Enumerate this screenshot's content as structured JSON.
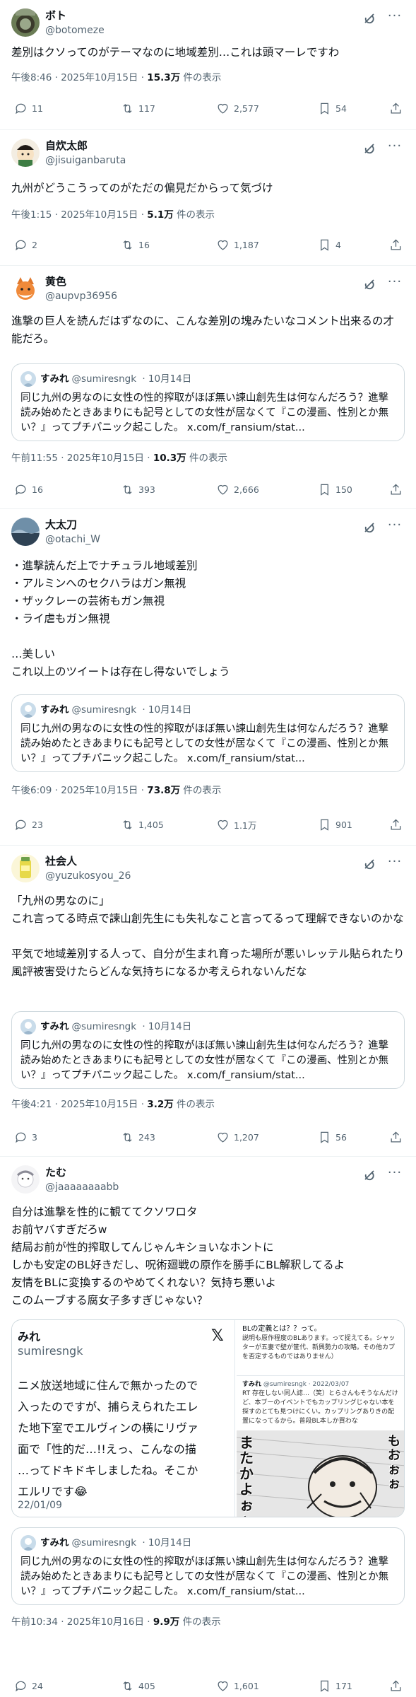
{
  "ui": {
    "more_glyph": "···",
    "views_suffix": "件の表示",
    "separator": " · ",
    "colors": {
      "text": "#0f1419",
      "secondary": "#536471",
      "border": "#cfd9de",
      "link": "#1d9bf0"
    }
  },
  "quoted": {
    "name": "すみれ",
    "handle": "@sumiresngk",
    "date": "10月14日",
    "text": "同じ九州の男なのに女性の性的搾取がほぼ無い諫山創先生は何なんだろう？進撃読み始めたときあまりにも記号としての女性が居なくて『この漫画、性別とか無い？』ってプチパニック起こした。 x.com/f_ransium/stat..."
  },
  "posts": [
    {
      "name": "ボト",
      "handle": "@botomeze",
      "text": "差別はクソってのがテーマなのに地域差別…これは頭マーレですわ",
      "time": "午後8:46",
      "date": "2025年10月15日",
      "views": "15.3万",
      "replies": "11",
      "reposts": "117",
      "likes": "2,577",
      "bookmarks": "54"
    },
    {
      "name": "自炊太郎",
      "handle": "@jisuiganbaruta",
      "text": "九州がどうこうってのがただの偏見だからって気づけ",
      "time": "午後1:15",
      "date": "2025年10月15日",
      "views": "5.1万",
      "replies": "2",
      "reposts": "16",
      "likes": "1,187",
      "bookmarks": "4"
    },
    {
      "name": "黄色",
      "handle": "@aupvp36956",
      "text": "進撃の巨人を読んだはずなのに、こんな差別の塊みたいなコメント出来るの才能だろ。",
      "time": "午前11:55",
      "date": "2025年10月15日",
      "views": "10.3万",
      "replies": "16",
      "reposts": "393",
      "likes": "2,666",
      "bookmarks": "150"
    },
    {
      "name": "大太刀",
      "handle": "@otachi_W",
      "text": "・進撃読んだ上でナチュラル地域差別\n・アルミンへのセクハラはガン無視\n・ザックレーの芸術もガン無視\n・ライ虐もガン無視\n\n…美しい\nこれ以上のツイートは存在し得ないでしょう",
      "time": "午後6:09",
      "date": "2025年10月15日",
      "views": "73.8万",
      "replies": "23",
      "reposts": "1,405",
      "likes": "1.1万",
      "bookmarks": "901"
    },
    {
      "name": "社会人",
      "handle": "@yuzukosyou_26",
      "text": "「九州の男なのに」\nこれ言ってる時点で諫山創先生にも失礼なこと言ってるって理解できないのかな\n\n平気で地域差別する人って、自分が生まれ育った場所が悪いレッテル貼られたり風評被害受けたらどんな気持ちになるか考えられないんだな",
      "time": "午後4:21",
      "date": "2025年10月15日",
      "views": "3.2万",
      "replies": "3",
      "reposts": "243",
      "likes": "1,207",
      "bookmarks": "56"
    },
    {
      "name": "たむ",
      "handle": "@jaaaaaaaabb",
      "text": "自分は進撃を性的に観ててクソワロタ\nお前ヤバすぎだろw\n結局お前が性的搾取してんじゃんキショいなホントに\nしかも安定のBL好きだし、呪術廻戦の原作を勝手にBL解釈してるよ\n友情をBLに変換するのやめてくれない？気持ち悪いよ\nこのムーブする腐女子多すぎじゃない？",
      "time": "午前10:34",
      "date": "2025年10月16日",
      "views": "9.9万",
      "replies": "24",
      "reposts": "405",
      "likes": "1,601",
      "bookmarks": "171"
    }
  ],
  "media": {
    "left_name": "みれ",
    "left_handle": "sumiresngk",
    "left_logo": "𝕏",
    "left_lines": [
      "ニメ放送地域に住んで無かったので",
      "入ったのですが、捕らえられたエレ",
      "た地下室でエルヴィンの横にリヴァ",
      "面で「性的だ…!!えっ、こんなの描",
      "…ってドキドキしましたね。そこか",
      "エルリです😂"
    ],
    "left_date": "22/01/09",
    "right_top_title": "BLの定義とは？？って。",
    "right_top_text": "説明も原作程度のBLあります。って捉えてる。シャッターが五妻で壁が筐代、新興勢力の攻略。その他カプを否定するものではありません）",
    "right_mid_name": "すみれ",
    "right_mid_handle": "@sumiresngk · 2022/03/07",
    "right_mid_text": "RT 存在しない同人誌…（笑）とらさんもそうなんだけど、本ブーのイベントでもカップリングじゃない本を探すのとても見つけにくい。カップリングありきの配置になってるから。普段BL本しか買わな",
    "manga_text_1": "またかよぉぉ",
    "manga_text_2": "もおぉぉ"
  }
}
